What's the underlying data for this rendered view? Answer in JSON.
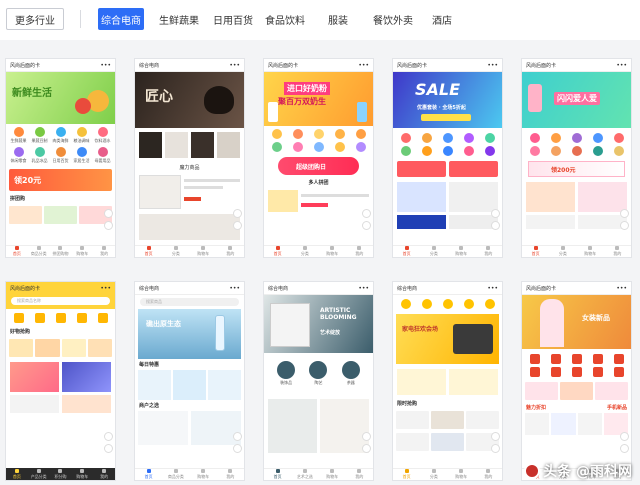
{
  "filter": {
    "more_label": "更多行业",
    "categories": [
      {
        "label": "综合电商",
        "active": true
      },
      {
        "label": "生鲜蔬果",
        "active": false
      },
      {
        "label": "日用百货",
        "active": false
      },
      {
        "label": "食品饮料",
        "active": false
      },
      {
        "label": "服装",
        "active": false
      },
      {
        "label": "餐饮外卖",
        "active": false
      },
      {
        "label": "酒店",
        "active": false
      }
    ]
  },
  "cards": [
    {
      "header": "风尚后面的卡",
      "banner_text": "新鲜生活",
      "banner_color": "#8ed35a",
      "icon_labels": [
        "生鲜蔬果",
        "果蔬豆制",
        "肉类海鲜",
        "粮油调味",
        "饮料酒水",
        "休闲零食",
        "乳品冰品",
        "日用百货",
        "家居生活",
        "母婴用品"
      ],
      "promo_text": "领20元",
      "section_label": "拼团购",
      "tabs": [
        "首页",
        "商品分类",
        "拼团购物",
        "购物车",
        "我的"
      ]
    },
    {
      "header": "综合电商",
      "banner_text": "匠心",
      "banner_color": "#3a2e28",
      "section_label": "魔力商品",
      "tabs": [
        "首页",
        "分类",
        "购物车",
        "我的"
      ]
    },
    {
      "header": "风尚后面的卡",
      "banner_text": "进口好奶粉",
      "banner_sub": "聚百万双奶生",
      "banner_color": "#ffcf33",
      "section_label": "多人拼团",
      "promo_text": "超级团购日",
      "tabs": [
        "首页",
        "分类",
        "购物车",
        "我的"
      ]
    },
    {
      "header": "风尚后面的卡",
      "banner_text": "SALE",
      "banner_sub": "优惠套装 · 全场5折起",
      "banner_color": "#2b57d8",
      "tabs": [
        "首页",
        "分类",
        "购物车",
        "我的"
      ]
    },
    {
      "header": "风尚后面的卡",
      "banner_text": "闪闪爱人爱",
      "banner_color": "#39c2c9",
      "promo_text": "领200元",
      "tabs": [
        "首页",
        "分类",
        "购物车",
        "我的"
      ]
    },
    {
      "header": "风尚后面的卡",
      "search_placeholder": "搜索商品名称",
      "section_label": "好物抢购",
      "tabs": [
        "首页",
        "产品分类",
        "积分购",
        "购物车",
        "我的"
      ]
    },
    {
      "header": "综合电商",
      "search_placeholder": "搜索商品",
      "banner_text": "礁出原生态",
      "banner_color": "#7fb7d6",
      "section_label": "每日特惠",
      "section_label2": "商户之选",
      "tabs": [
        "首页",
        "商品分类",
        "购物车",
        "我的"
      ]
    },
    {
      "header": "综合电商",
      "banner_text": "ARTISTIC BLOOMING",
      "banner_sub": "艺术绽放",
      "banner_color": "#3b5d6b",
      "icon_labels": [
        "装饰品",
        "陶艺",
        "茶器"
      ],
      "tabs": [
        "首页",
        "艺术之选",
        "购物车",
        "我的"
      ]
    },
    {
      "header": "综合电商",
      "promo_text": "家电狂欢会场",
      "section_label": "限时抢购",
      "tabs": [
        "首页",
        "分类",
        "购物车",
        "我的"
      ]
    },
    {
      "header": "风尚后面的卡",
      "banner_text": "女装新品",
      "banner_color": "#f0a23b",
      "section_label": "魅力折扣",
      "section_label2": "手机新品",
      "tabs": [
        "首页",
        "分类",
        "购物车",
        "我的"
      ]
    }
  ],
  "watermark": {
    "text": "头条 @雨科网"
  }
}
